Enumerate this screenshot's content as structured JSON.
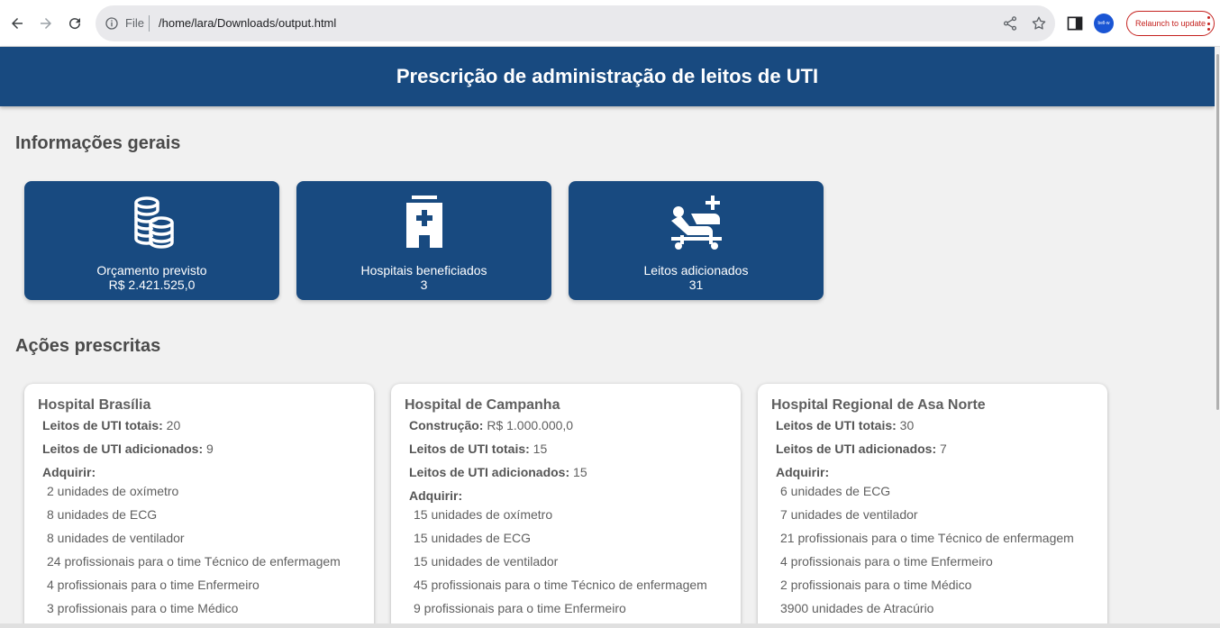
{
  "browser": {
    "file_label": "File",
    "url": "/home/lara/Downloads/output.html",
    "avatar_text": "bell-w",
    "relaunch_label": "Relaunch to update"
  },
  "page": {
    "title": "Prescrição de administração de leitos de UTI"
  },
  "general": {
    "heading": "Informações gerais",
    "cards": [
      {
        "icon": "coins-icon",
        "label": "Orçamento previsto",
        "value": "R$ 2.421.525,0"
      },
      {
        "icon": "hospital-icon",
        "label": "Hospitais beneficiados",
        "value": "3"
      },
      {
        "icon": "hospital-bed-icon",
        "label": "Leitos adicionados",
        "value": "31"
      }
    ]
  },
  "actions": {
    "heading": "Ações prescritas",
    "hospitals": [
      {
        "name": "Hospital Brasília",
        "rows": [
          {
            "label": "Leitos de UTI totais:",
            "value": " 20"
          },
          {
            "label": "Leitos de UTI adicionados:",
            "value": " 9"
          }
        ],
        "acquire_label": "Adquirir:",
        "items": [
          "2 unidades de oxímetro",
          "8 unidades de ECG",
          "8 unidades de ventilador",
          "24 profissionais para o time Técnico de enfermagem",
          "4 profissionais para o time Enfermeiro",
          "3 profissionais para o time Médico"
        ]
      },
      {
        "name": "Hospital de Campanha",
        "rows": [
          {
            "label": "Construção:",
            "value": " R$ 1.000.000,0"
          },
          {
            "label": "Leitos de UTI totais:",
            "value": " 15"
          },
          {
            "label": "Leitos de UTI adicionados:",
            "value": " 15"
          }
        ],
        "acquire_label": "Adquirir:",
        "items": [
          "15 unidades de oxímetro",
          "15 unidades de ECG",
          "15 unidades de ventilador",
          "45 profissionais para o time Técnico de enfermagem",
          "9 profissionais para o time Enfermeiro"
        ]
      },
      {
        "name": "Hospital Regional de Asa Norte",
        "rows": [
          {
            "label": "Leitos de UTI totais:",
            "value": " 30"
          },
          {
            "label": "Leitos de UTI adicionados:",
            "value": " 7"
          }
        ],
        "acquire_label": "Adquirir:",
        "items": [
          "6 unidades de ECG",
          "7 unidades de ventilador",
          "21 profissionais para o time Técnico de enfermagem",
          "4 profissionais para o time Enfermeiro",
          "2 profissionais para o time Médico",
          "3900 unidades de Atracúrio"
        ]
      }
    ]
  }
}
